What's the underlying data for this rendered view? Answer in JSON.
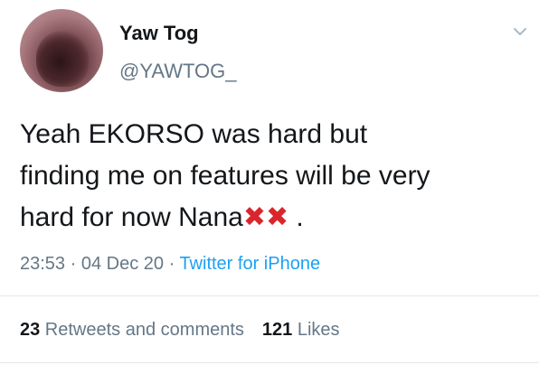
{
  "author": {
    "display_name": "Yaw Tog",
    "handle": "@YAWTOG_"
  },
  "tweet": {
    "lines": [
      "Yeah EKORSO was hard but",
      "finding me on features will be very",
      "hard for now Nana"
    ],
    "emoji": [
      "✖",
      "✖"
    ],
    "trailing": " ."
  },
  "meta": {
    "time": "23:53",
    "separator": " · ",
    "date": "04 Dec 20",
    "source": "Twitter for iPhone"
  },
  "stats": {
    "retweets_count": "23",
    "retweets_label": " Retweets and comments",
    "likes_count": "121",
    "likes_label": " Likes"
  },
  "icons": {
    "menu": "chevron-down-icon",
    "cross": "cross-mark-icon"
  },
  "colors": {
    "text": "#14171a",
    "secondary": "#657786",
    "link": "#1da1f2",
    "emoji": "#d9262c",
    "divider": "#e1e8ed"
  }
}
